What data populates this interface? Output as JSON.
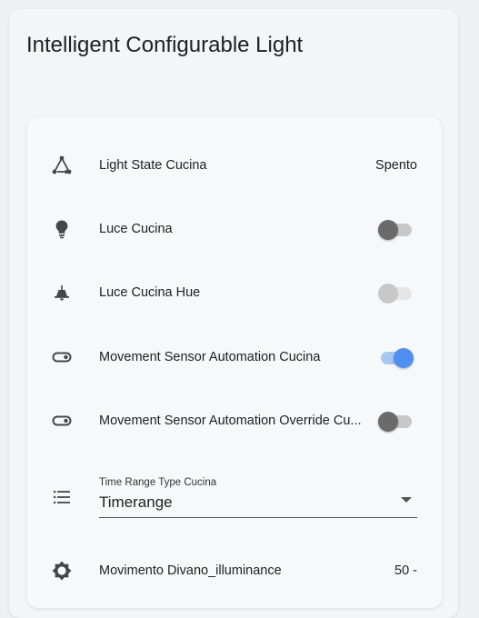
{
  "card": {
    "title": "Intelligent Configurable Light"
  },
  "rows": {
    "light_state": {
      "label": "Light State Cucina",
      "state": "Spento",
      "icon": "state-machine-icon"
    },
    "luce_cucina": {
      "label": "Luce Cucina",
      "icon": "lightbulb-icon",
      "toggle": "off"
    },
    "luce_cucina_hue": {
      "label": "Luce Cucina Hue",
      "icon": "ceiling-light-icon",
      "toggle": "off-disabled"
    },
    "movement_auto": {
      "label": "Movement Sensor Automation Cucina",
      "icon": "toggle-switch-icon",
      "toggle": "on"
    },
    "movement_override": {
      "label": "Movement Sensor Automation Override Cu...",
      "icon": "toggle-switch-icon",
      "toggle": "off"
    },
    "time_range": {
      "floating_label": "Time Range Type Cucina",
      "value": "Timerange",
      "icon": "format-list-icon"
    },
    "illuminance": {
      "label": "Movimento Divano_illuminance",
      "state": "50 -",
      "icon": "brightness-icon"
    }
  },
  "colors": {
    "accent": "#4f8ff2",
    "icon": "#44474a",
    "background": "#eef0f2"
  }
}
